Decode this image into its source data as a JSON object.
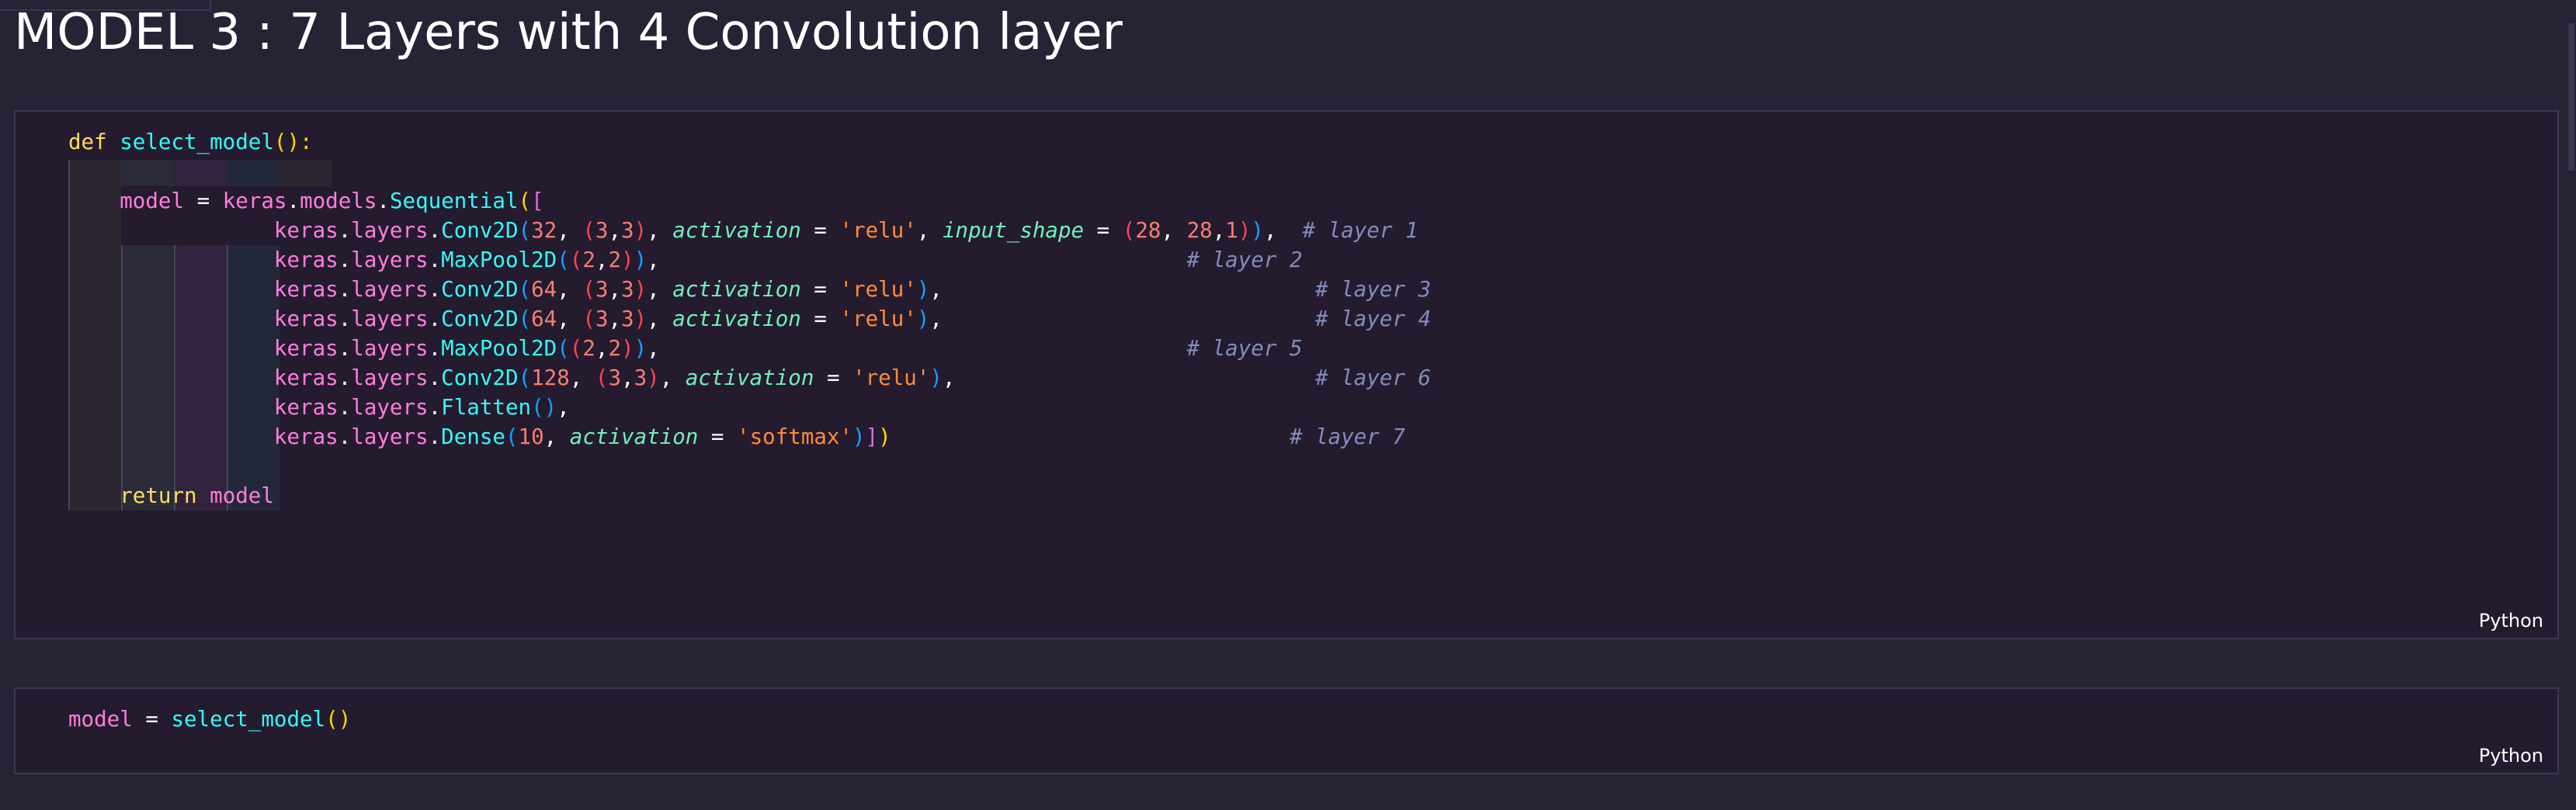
{
  "heading": "MODEL 3 : 7 Layers with 4 Convolution layer",
  "cells": [
    {
      "language": "Python",
      "lines": [
        [
          [
            "kw",
            "def "
          ],
          [
            "fn",
            "select_model"
          ],
          [
            "b1",
            "():"
          ]
        ],
        [],
        [
          [
            "op",
            "    "
          ],
          [
            "var",
            "model"
          ],
          [
            "op",
            " = "
          ],
          [
            "var",
            "keras"
          ],
          [
            "op",
            "."
          ],
          [
            "var",
            "models"
          ],
          [
            "op",
            "."
          ],
          [
            "fn",
            "Sequential"
          ],
          [
            "b1",
            "("
          ],
          [
            "b2",
            "["
          ]
        ],
        [
          [
            "op",
            "                "
          ],
          [
            "var",
            "keras"
          ],
          [
            "op",
            "."
          ],
          [
            "var",
            "layers"
          ],
          [
            "op",
            "."
          ],
          [
            "fn",
            "Conv2D"
          ],
          [
            "b3",
            "("
          ],
          [
            "num",
            "32"
          ],
          [
            "op",
            ", "
          ],
          [
            "bp",
            "("
          ],
          [
            "num",
            "3"
          ],
          [
            "op",
            ","
          ],
          [
            "num",
            "3"
          ],
          [
            "bp",
            ")"
          ],
          [
            "op",
            ", "
          ],
          [
            "prm",
            "activation"
          ],
          [
            "op",
            " = "
          ],
          [
            "str",
            "'relu'"
          ],
          [
            "op",
            ", "
          ],
          [
            "prm",
            "input_shape"
          ],
          [
            "op",
            " = "
          ],
          [
            "bp",
            "("
          ],
          [
            "num",
            "28"
          ],
          [
            "op",
            ", "
          ],
          [
            "num",
            "28"
          ],
          [
            "op",
            ","
          ],
          [
            "num",
            "1"
          ],
          [
            "bp",
            ")"
          ],
          [
            "b3",
            ")"
          ],
          [
            "op",
            ",  "
          ],
          [
            "cmt",
            "# layer 1"
          ]
        ],
        [
          [
            "op",
            "                "
          ],
          [
            "var",
            "keras"
          ],
          [
            "op",
            "."
          ],
          [
            "var",
            "layers"
          ],
          [
            "op",
            "."
          ],
          [
            "fn",
            "MaxPool2D"
          ],
          [
            "b3",
            "("
          ],
          [
            "bp",
            "("
          ],
          [
            "num",
            "2"
          ],
          [
            "op",
            ","
          ],
          [
            "num",
            "2"
          ],
          [
            "bp",
            ")"
          ],
          [
            "b3",
            ")"
          ],
          [
            "op",
            ",                                         "
          ],
          [
            "cmt",
            "# layer 2"
          ]
        ],
        [
          [
            "op",
            "                "
          ],
          [
            "var",
            "keras"
          ],
          [
            "op",
            "."
          ],
          [
            "var",
            "layers"
          ],
          [
            "op",
            "."
          ],
          [
            "fn",
            "Conv2D"
          ],
          [
            "b3",
            "("
          ],
          [
            "num",
            "64"
          ],
          [
            "op",
            ", "
          ],
          [
            "bp",
            "("
          ],
          [
            "num",
            "3"
          ],
          [
            "op",
            ","
          ],
          [
            "num",
            "3"
          ],
          [
            "bp",
            ")"
          ],
          [
            "op",
            ", "
          ],
          [
            "prm",
            "activation"
          ],
          [
            "op",
            " = "
          ],
          [
            "str",
            "'relu'"
          ],
          [
            "b3",
            ")"
          ],
          [
            "op",
            ",                             "
          ],
          [
            "cmt",
            "# layer 3"
          ]
        ],
        [
          [
            "op",
            "                "
          ],
          [
            "var",
            "keras"
          ],
          [
            "op",
            "."
          ],
          [
            "var",
            "layers"
          ],
          [
            "op",
            "."
          ],
          [
            "fn",
            "Conv2D"
          ],
          [
            "b3",
            "("
          ],
          [
            "num",
            "64"
          ],
          [
            "op",
            ", "
          ],
          [
            "bp",
            "("
          ],
          [
            "num",
            "3"
          ],
          [
            "op",
            ","
          ],
          [
            "num",
            "3"
          ],
          [
            "bp",
            ")"
          ],
          [
            "op",
            ", "
          ],
          [
            "prm",
            "activation"
          ],
          [
            "op",
            " = "
          ],
          [
            "str",
            "'relu'"
          ],
          [
            "b3",
            ")"
          ],
          [
            "op",
            ",                             "
          ],
          [
            "cmt",
            "# layer 4"
          ]
        ],
        [
          [
            "op",
            "                "
          ],
          [
            "var",
            "keras"
          ],
          [
            "op",
            "."
          ],
          [
            "var",
            "layers"
          ],
          [
            "op",
            "."
          ],
          [
            "fn",
            "MaxPool2D"
          ],
          [
            "b3",
            "("
          ],
          [
            "bp",
            "("
          ],
          [
            "num",
            "2"
          ],
          [
            "op",
            ","
          ],
          [
            "num",
            "2"
          ],
          [
            "bp",
            ")"
          ],
          [
            "b3",
            ")"
          ],
          [
            "op",
            ",                                         "
          ],
          [
            "cmt",
            "# layer 5"
          ]
        ],
        [
          [
            "op",
            "                "
          ],
          [
            "var",
            "keras"
          ],
          [
            "op",
            "."
          ],
          [
            "var",
            "layers"
          ],
          [
            "op",
            "."
          ],
          [
            "fn",
            "Conv2D"
          ],
          [
            "b3",
            "("
          ],
          [
            "num",
            "128"
          ],
          [
            "op",
            ", "
          ],
          [
            "bp",
            "("
          ],
          [
            "num",
            "3"
          ],
          [
            "op",
            ","
          ],
          [
            "num",
            "3"
          ],
          [
            "bp",
            ")"
          ],
          [
            "op",
            ", "
          ],
          [
            "prm",
            "activation"
          ],
          [
            "op",
            " = "
          ],
          [
            "str",
            "'relu'"
          ],
          [
            "b3",
            ")"
          ],
          [
            "op",
            ",                            "
          ],
          [
            "cmt",
            "# layer 6"
          ]
        ],
        [
          [
            "op",
            "                "
          ],
          [
            "var",
            "keras"
          ],
          [
            "op",
            "."
          ],
          [
            "var",
            "layers"
          ],
          [
            "op",
            "."
          ],
          [
            "fn",
            "Flatten"
          ],
          [
            "b3",
            "()"
          ],
          [
            "op",
            ","
          ]
        ],
        [
          [
            "op",
            "                "
          ],
          [
            "var",
            "keras"
          ],
          [
            "op",
            "."
          ],
          [
            "var",
            "layers"
          ],
          [
            "op",
            "."
          ],
          [
            "fn",
            "Dense"
          ],
          [
            "b3",
            "("
          ],
          [
            "num",
            "10"
          ],
          [
            "op",
            ", "
          ],
          [
            "prm",
            "activation"
          ],
          [
            "op",
            " = "
          ],
          [
            "str",
            "'softmax'"
          ],
          [
            "b3",
            ")"
          ],
          [
            "b2",
            "]"
          ],
          [
            "b1",
            ")"
          ],
          [
            "op",
            "                               "
          ],
          [
            "cmt",
            "# layer 7"
          ]
        ],
        [],
        [
          [
            "op",
            "    "
          ],
          [
            "kw",
            "return "
          ],
          [
            "var",
            "model"
          ]
        ]
      ]
    },
    {
      "language": "Python",
      "lines": [
        [
          [
            "var",
            "model"
          ],
          [
            "op",
            " = "
          ],
          [
            "fn",
            "select_model"
          ],
          [
            "b1",
            "()"
          ]
        ]
      ]
    }
  ]
}
